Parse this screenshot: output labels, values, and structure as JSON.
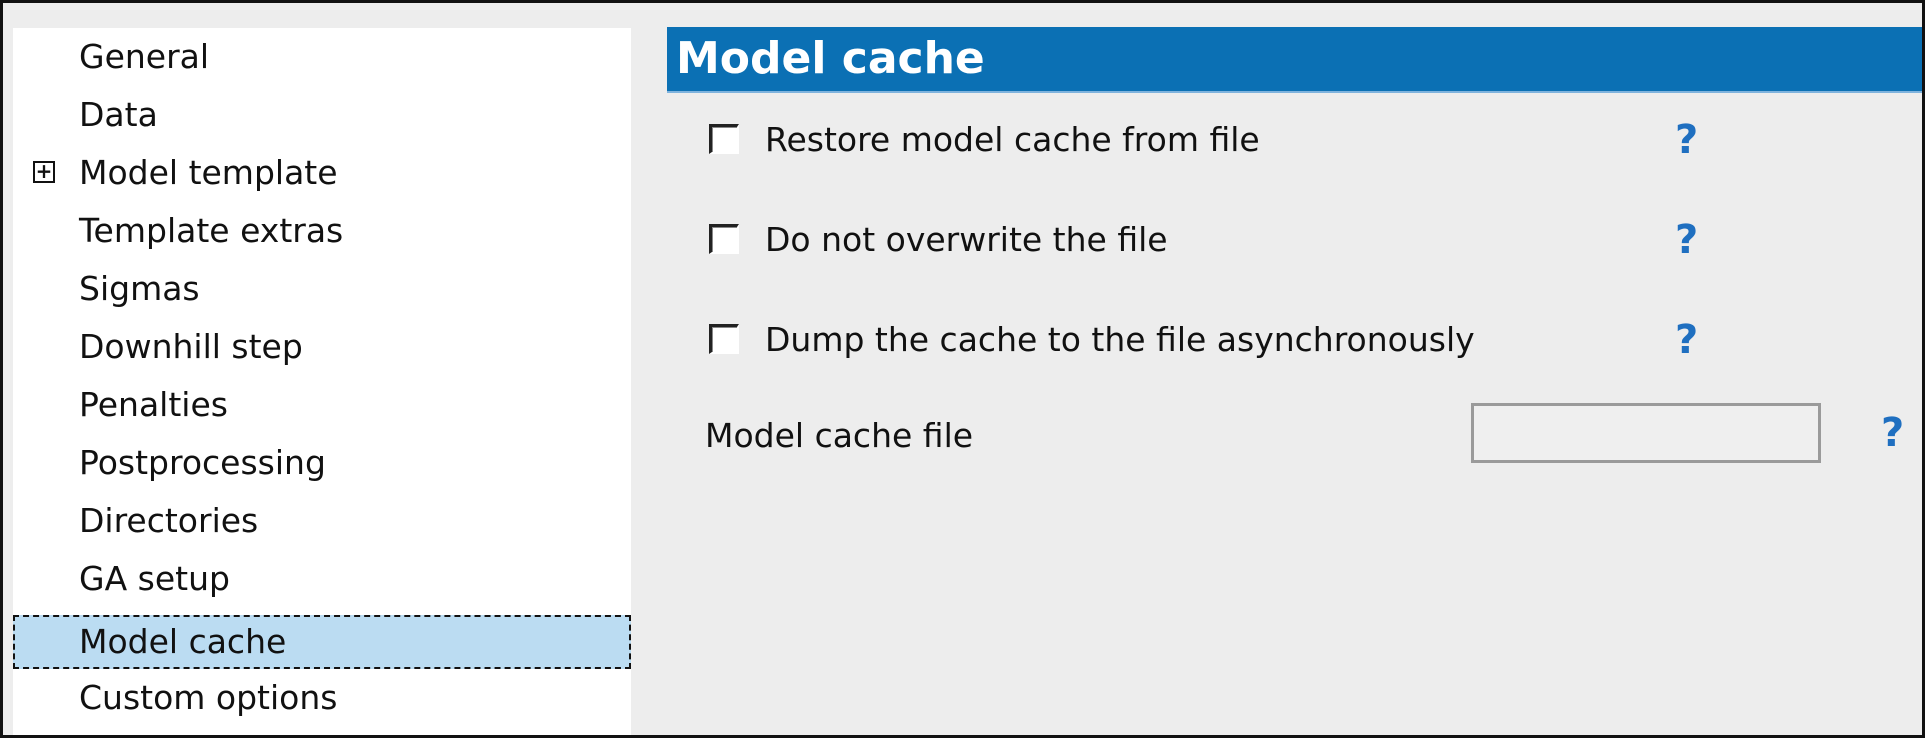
{
  "sidebar": {
    "items": [
      {
        "label": "General",
        "expandable": false,
        "selected": false
      },
      {
        "label": "Data",
        "expandable": false,
        "selected": false
      },
      {
        "label": "Model template",
        "expandable": true,
        "expander": "+",
        "selected": false
      },
      {
        "label": "Template extras",
        "expandable": false,
        "selected": false
      },
      {
        "label": "Sigmas",
        "expandable": false,
        "selected": false
      },
      {
        "label": "Downhill step",
        "expandable": false,
        "selected": false
      },
      {
        "label": "Penalties",
        "expandable": false,
        "selected": false
      },
      {
        "label": "Postprocessing",
        "expandable": false,
        "selected": false
      },
      {
        "label": "Directories",
        "expandable": false,
        "selected": false
      },
      {
        "label": "GA setup",
        "expandable": false,
        "selected": false
      },
      {
        "label": "Model cache",
        "expandable": false,
        "selected": true
      },
      {
        "label": "Custom options",
        "expandable": false,
        "selected": false
      }
    ]
  },
  "panel": {
    "title": "Model cache",
    "options": [
      {
        "label": "Restore model cache from file",
        "checked": false,
        "help": "?"
      },
      {
        "label": "Do not overwrite the file",
        "checked": false,
        "help": "?"
      },
      {
        "label": "Dump the cache to the file asynchronously",
        "checked": false,
        "help": "?"
      }
    ],
    "file_field": {
      "label": "Model cache file",
      "value": "",
      "help": "?"
    }
  },
  "colors": {
    "header_bg": "#0b70b4",
    "selection_bg": "#bbdcf2",
    "help_icon": "#1f6fc0"
  }
}
